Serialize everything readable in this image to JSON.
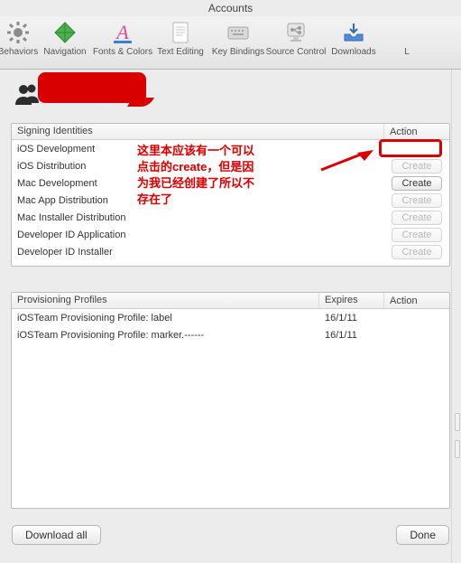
{
  "title": "Accounts",
  "toolbar": {
    "items": [
      {
        "label": "Behaviors",
        "icon": "gear-icon",
        "selected": false
      },
      {
        "label": "Navigation",
        "icon": "diamond-icon",
        "selected": false
      },
      {
        "label": "Fonts & Colors",
        "icon": "font-icon",
        "selected": false
      },
      {
        "label": "Text Editing",
        "icon": "page-icon",
        "selected": false
      },
      {
        "label": "Key Bindings",
        "icon": "keyboard-icon",
        "selected": false
      },
      {
        "label": "Source Control",
        "icon": "branch-icon",
        "selected": false
      },
      {
        "label": "Downloads",
        "icon": "tray-icon",
        "selected": false
      },
      {
        "label": "L",
        "icon": "blank-icon",
        "selected": false
      }
    ]
  },
  "identities": {
    "header_name": "Signing Identities",
    "header_action": "Action",
    "rows": [
      {
        "name": "iOS Development",
        "action": "",
        "state": "empty"
      },
      {
        "name": "iOS Distribution",
        "action": "Create",
        "state": "disabled"
      },
      {
        "name": "Mac Development",
        "action": "Create",
        "state": "enabled"
      },
      {
        "name": "Mac App Distribution",
        "action": "Create",
        "state": "disabled"
      },
      {
        "name": "Mac Installer Distribution",
        "action": "Create",
        "state": "disabled"
      },
      {
        "name": "Developer ID Application",
        "action": "Create",
        "state": "disabled"
      },
      {
        "name": "Developer ID Installer",
        "action": "Create",
        "state": "disabled"
      }
    ]
  },
  "profiles": {
    "header_name": "Provisioning Profiles",
    "header_expires": "Expires",
    "header_action": "Action",
    "rows": [
      {
        "name": "iOSTeam Provisioning Profile: label",
        "expires": "16/1/11",
        "action": ""
      },
      {
        "name": "iOSTeam Provisioning Profile: marker.------",
        "expires": "16/1/11",
        "action": ""
      }
    ]
  },
  "buttons": {
    "download_all": "Download all",
    "done": "Done"
  },
  "annotation": {
    "line1": "这里本应该有一个可以",
    "line2_pre": "点击的",
    "line2_kw": "create",
    "line2_post": "，但是因",
    "line3": "为我已经创建了所以不",
    "line4": "存在了"
  }
}
